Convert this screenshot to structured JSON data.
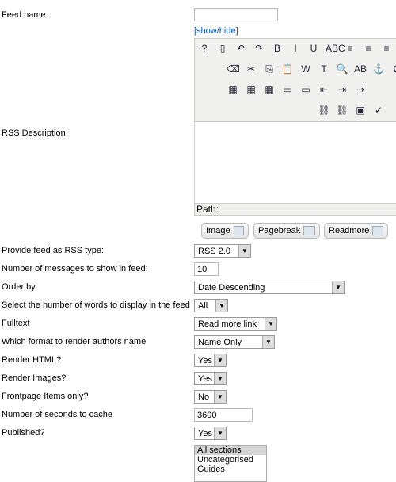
{
  "feed_name": {
    "label": "Feed name:",
    "value": ""
  },
  "show_hide": "[show/hide]",
  "rss_description_label": "RSS Description",
  "editor": {
    "path_label": "Path:",
    "row1": [
      "help-icon",
      "new-document-icon",
      "undo-icon",
      "redo-icon",
      "bold-icon",
      "italic-icon",
      "underline-icon",
      "strikethrough-icon",
      "align-left-icon",
      "align-center-icon",
      "align-justify-icon"
    ],
    "row1_glyphs": [
      "?",
      "▯",
      "↶",
      "↷",
      "B",
      "I",
      "U",
      "ABC",
      "≡",
      "≡",
      "≡"
    ],
    "row2": [
      "eraser-icon",
      "cut-icon",
      "copy-icon",
      "paste-icon",
      "paste-word-icon",
      "paste-text-icon",
      "find-icon",
      "replace-icon",
      "anchor-icon",
      "special-char-icon"
    ],
    "row2_glyphs": [
      "⌫",
      "✂",
      "⎘",
      "📋",
      "W",
      "T",
      "🔍",
      "AB",
      "⚓",
      "Ω"
    ],
    "row3": [
      "table-icon",
      "delete-table-icon",
      "table-props-icon",
      "row-icon",
      "cell-icon",
      "indent-icon",
      "outdent-icon",
      "move-icon"
    ],
    "row3_glyphs": [
      "▦",
      "▦",
      "▦",
      "▭",
      "▭",
      "⇤",
      "⇥",
      "⇢"
    ],
    "row4": [
      "unlink-icon",
      "link-icon",
      "image-icon",
      "spellcheck-icon"
    ],
    "row4_glyphs": [
      "⛓",
      "⛓",
      "▣",
      "✓"
    ]
  },
  "buttons": {
    "image": "Image",
    "pagebreak": "Pagebreak",
    "readmore": "Readmore"
  },
  "fields": [
    {
      "label": "Provide feed as RSS type:",
      "value": "RSS 2.0"
    },
    {
      "label": "Number of messages to show in feed:",
      "value": "10"
    },
    {
      "label": "Order by",
      "value": "Date Descending"
    },
    {
      "label": "Select the number of words to display in the feed",
      "value": "All"
    },
    {
      "label": "Fulltext",
      "value": "Read more link"
    },
    {
      "label": "Which format to render authors name",
      "value": "Name Only"
    },
    {
      "label": "Render HTML?",
      "value": "Yes"
    },
    {
      "label": "Render Images?",
      "value": "Yes"
    },
    {
      "label": "Frontpage Items only?",
      "value": "No"
    },
    {
      "label": "Number of seconds to cache",
      "value": "3600"
    },
    {
      "label": "Published?",
      "value": "Yes"
    }
  ],
  "sections": [
    "All sections",
    "Uncategorised",
    "Guides"
  ]
}
